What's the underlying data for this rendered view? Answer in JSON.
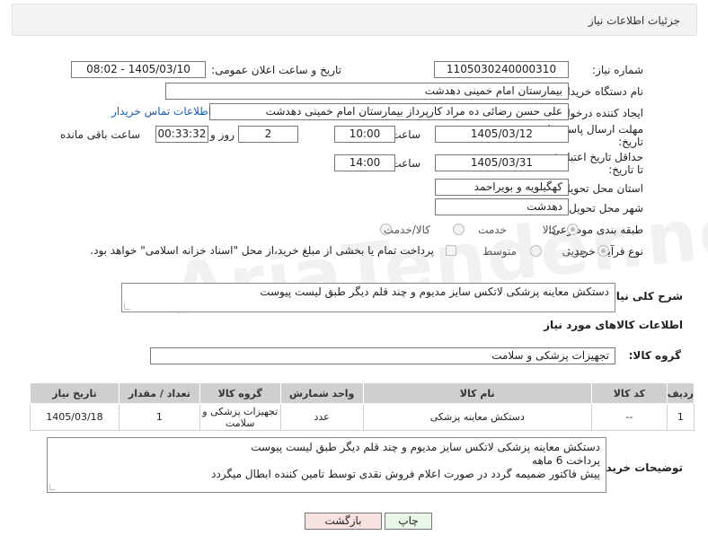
{
  "panel": {
    "title": "جزئیات اطلاعات نیاز"
  },
  "labels": {
    "need_number": "شماره نیاز:",
    "announce_datetime": "تاریخ و ساعت اعلان عمومی:",
    "buyer_org": "نام دستگاه خریدار:",
    "creator": "ایجاد کننده درخواست:",
    "reply_deadline_1": "مهلت ارسال پاسخ: تا",
    "reply_deadline_2": "تاریخ:",
    "price_validity_1": "حداقل تاریخ اعتبار قیمت:",
    "price_validity_2": "تا تاریخ:",
    "time": "ساعت",
    "days_and": "روز و",
    "time_remaining": "ساعت باقی مانده",
    "delivery_province": "استان محل تحویل:",
    "delivery_city": "شهر محل تحویل:",
    "category": "طبقه بندی موضوعی:",
    "process_type": "نوع فرآیند خرید :",
    "description": "شرح کلی نیاز:",
    "goods_info": "اطلاعات کالاهای مورد نیاز",
    "goods_group": "گروه کالا:",
    "buyer_notes": "توضیحات خریدار:"
  },
  "values": {
    "need_number": "1105030240000310",
    "announce_datetime": "1405/03/10 - 08:02",
    "buyer_org": "بیمارستان امام خمینی دهدشت",
    "creator": "علی حسن رضائی ده مراد کارپرداز بیمارستان امام خمینی دهدشت",
    "contact_link": "اطلاعات تماس خریدار",
    "reply_date": "1405/03/12",
    "reply_time": "10:00",
    "reply_days": "2",
    "reply_remaining": "00:33:32",
    "validity_date": "1405/03/31",
    "validity_time": "14:00",
    "province": "کهگیلویه و بویراحمد",
    "city": "دهدشت",
    "description": "دستکش معاینه پزشکی لاتکس سایز مدیوم و چند قلم دیگر طبق لیست پیوست",
    "goods_group": "تجهیزات پزشکی و سلامت",
    "buyer_notes_1": "دستکش معاینه پزشکی لاتکس سایز مدیوم و چند قلم دیگر طبق لیست پیوست",
    "buyer_notes_2": "پرداخت 6 ماهه",
    "buyer_notes_3": "پیش فاکتور ضمیمه گردد در صورت اعلام فروش نقدی توسط تامین کننده ابطال میگردد"
  },
  "category_options": [
    {
      "label": "کالا",
      "selected": true
    },
    {
      "label": "خدمت",
      "selected": false
    },
    {
      "label": "کالا/خدمت",
      "selected": false
    }
  ],
  "process_options": [
    {
      "label": "جزیی",
      "selected": true
    },
    {
      "label": "متوسط",
      "selected": false
    }
  ],
  "treasury_note": "پرداخت تمام یا بخشی از مبلغ خرید،از محل \"اسناد خزانه اسلامی\" خواهد بود.",
  "table": {
    "headers": [
      "ردیف",
      "کد کالا",
      "نام کالا",
      "واحد شمارش",
      "گروه کالا",
      "تعداد / مقدار",
      "تاریخ نیاز"
    ],
    "rows": [
      [
        "1",
        "--",
        "دستکش معاینه پزشکی",
        "عدد",
        "تجهیزات پزشکی و سلامت",
        "1",
        "1405/03/18"
      ]
    ]
  },
  "buttons": {
    "print": "چاپ",
    "back": "بازگشت"
  },
  "watermark": "AriaTender.neT",
  "colors": {
    "link": "#1a5fb4",
    "print_bg": "#e9f7e9",
    "back_bg": "#f8e1e1",
    "header_bg": "#cfcfcf"
  }
}
